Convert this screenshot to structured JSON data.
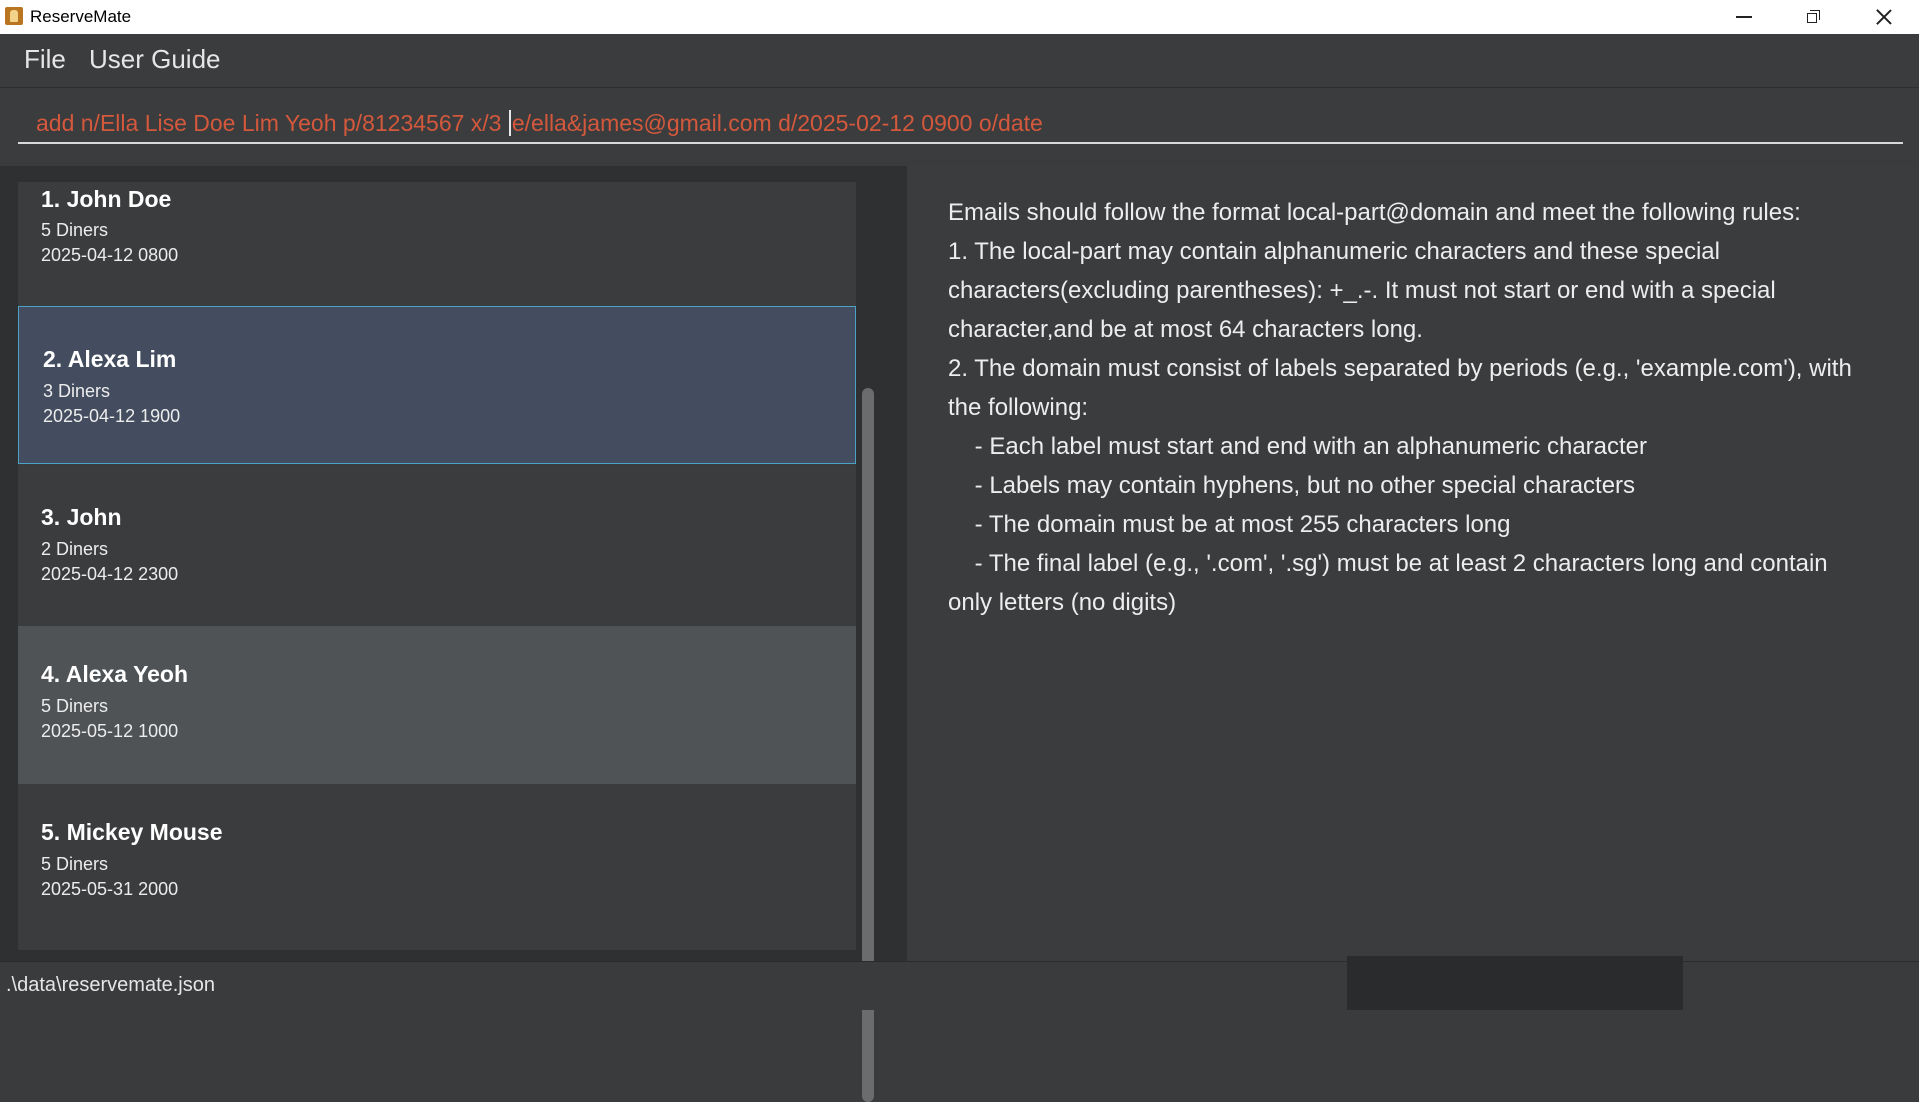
{
  "window": {
    "title": "ReserveMate",
    "controls": [
      "minimize",
      "restore",
      "close"
    ]
  },
  "menu": {
    "items": [
      {
        "label": "File"
      },
      {
        "label": "User Guide"
      }
    ]
  },
  "command": {
    "before_caret": "add n/Ella Lise Doe Lim Yeoh p/81234567 x/3 ",
    "after_caret": "e/ella&james@gmail.com d/2025-02-12 0900 o/date",
    "text_color": "#d4583c"
  },
  "reservations": [
    {
      "name": "1. John Doe",
      "diners": "5 Diners",
      "datetime": "2025-04-12 0800"
    },
    {
      "name": "2. Alexa Lim",
      "diners": "3 Diners",
      "datetime": "2025-04-12 1900",
      "selected": true
    },
    {
      "name": "3. John",
      "diners": "2 Diners",
      "datetime": "2025-04-12 2300"
    },
    {
      "name": "4. Alexa Yeoh",
      "diners": "5 Diners",
      "datetime": "2025-05-12 1000"
    },
    {
      "name": "5. Mickey Mouse",
      "diners": "5 Diners",
      "datetime": "2025-05-31 2000"
    }
  ],
  "result": {
    "lines": [
      "Emails should follow the format local-part@domain and meet the following rules:",
      "1. The local-part may contain alphanumeric characters and these special",
      "characters(excluding parentheses): +_.-. It must not start or end with a special",
      "character,and be at most 64 characters long.",
      "2. The domain must consist of labels separated by periods (e.g., 'example.com'), with",
      "the following:",
      "    - Each label must start and end with an alphanumeric character",
      "    - Labels may contain hyphens, but no other special characters",
      "    - The domain must be at most 255 characters long",
      "    - The final label (e.g., '.com', '.sg') must be at least 2 characters long and contain",
      "only letters (no digits)"
    ]
  },
  "status": {
    "file_path": ".\\data\\reservemate.json"
  },
  "colors": {
    "selected_card_bg": "#434d5f",
    "selected_card_border": "#4aa3c4",
    "hover_card_bg": "#4f5356"
  }
}
